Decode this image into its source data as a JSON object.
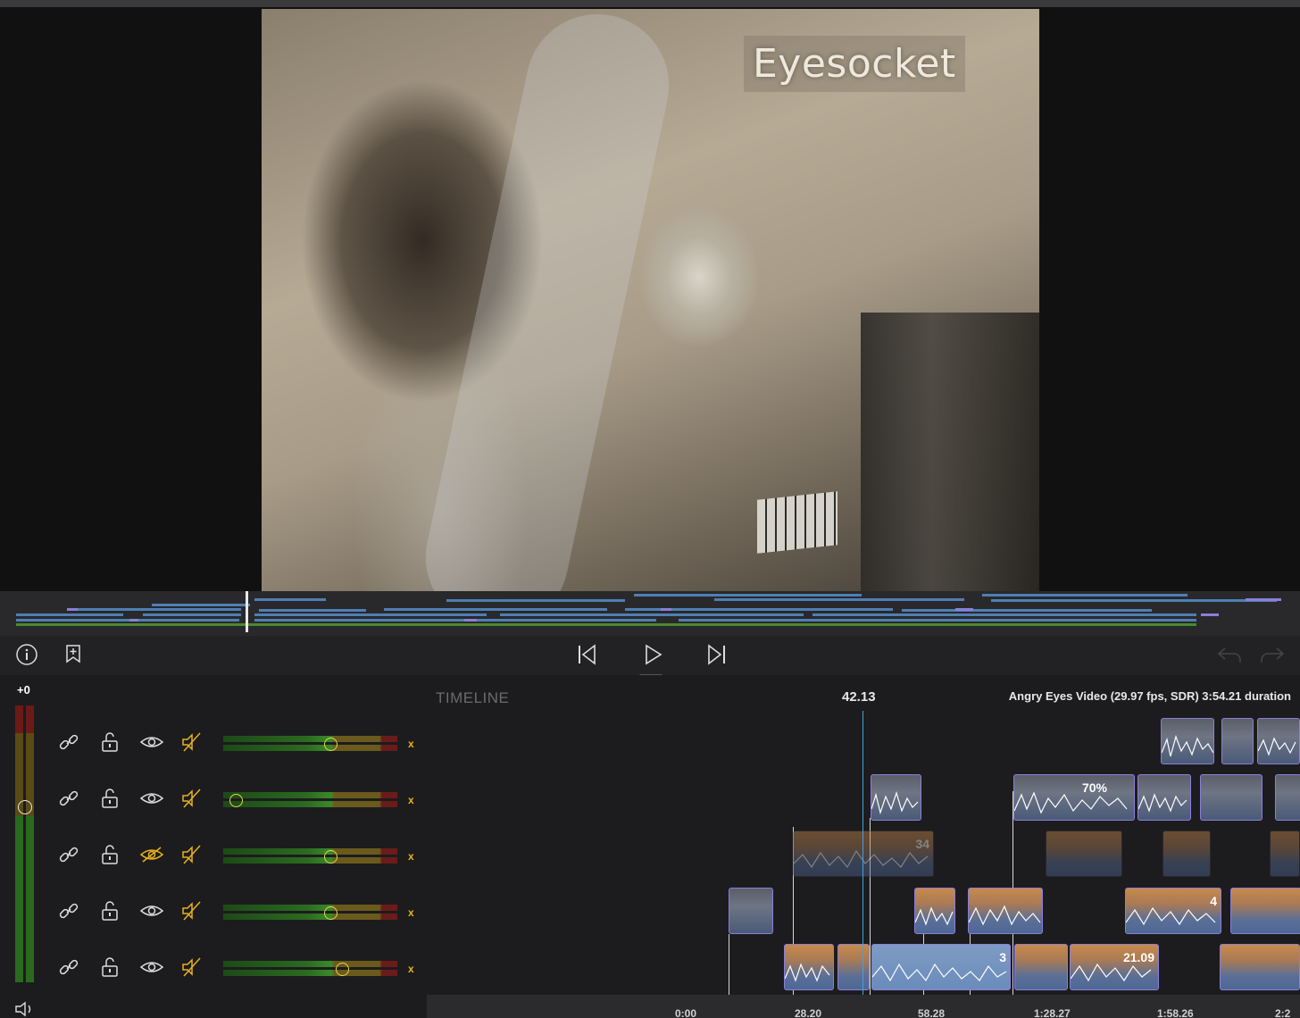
{
  "viewer": {
    "overlay_title": "Eyesocket"
  },
  "transport": {
    "info_icon": "info-circle-icon",
    "add_marker_icon": "bookmark-plus-icon",
    "skip_back_icon": "skip-back-icon",
    "play_icon": "play-icon",
    "skip_forward_icon": "skip-forward-icon",
    "undo_icon": "undo-icon",
    "redo_icon": "redo-icon"
  },
  "tracks": {
    "master_gain": "+0",
    "rows": [
      {
        "hidden": false,
        "volume": 0.63,
        "remove": "x"
      },
      {
        "hidden": false,
        "volume": 0.04,
        "remove": "x"
      },
      {
        "hidden": true,
        "volume": 0.63,
        "remove": "x"
      },
      {
        "hidden": false,
        "volume": 0.63,
        "remove": "x"
      },
      {
        "hidden": false,
        "volume": 0.7,
        "remove": "x"
      }
    ],
    "accent_color": "#e8b21f"
  },
  "timeline": {
    "label": "TIMELINE",
    "current_time": "42.13",
    "project_info": "Angry Eyes Video (29.97 fps, SDR)  3:54.21 duration",
    "clip_labels": [
      "70%",
      "34",
      "3",
      "21.09",
      "4"
    ],
    "ruler": [
      "0:00",
      "28.20",
      "58.28",
      "1:28.27",
      "1:58.26",
      "2:2"
    ]
  },
  "colors": {
    "playhead": "#4a9fd6",
    "clip_border": "#8b7fd9",
    "overview_blue": "#4f7fb4",
    "overview_purple": "#8b7fd9",
    "overview_green": "#4a8a2e"
  }
}
